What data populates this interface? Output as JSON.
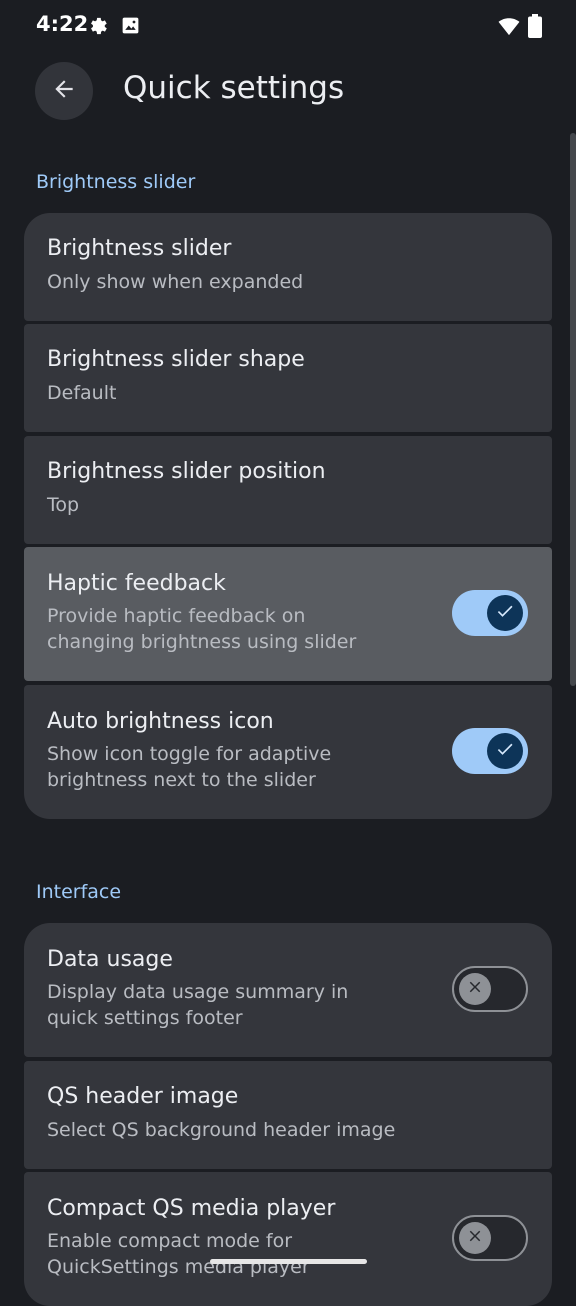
{
  "status_bar": {
    "time": "4:22",
    "icons": [
      "gear-icon",
      "image-icon",
      "wifi-icon",
      "battery-icon"
    ]
  },
  "app_bar": {
    "title": "Quick settings",
    "back_icon": "arrow-left-icon"
  },
  "sections": [
    {
      "header": "Brightness slider",
      "items": [
        {
          "title": "Brightness slider",
          "subtitle": "Only show when expanded",
          "switch": null
        },
        {
          "title": "Brightness slider shape",
          "subtitle": "Default",
          "switch": null
        },
        {
          "title": "Brightness slider position",
          "subtitle": "Top",
          "switch": null
        },
        {
          "title": "Haptic feedback",
          "subtitle_lines": [
            "Provide haptic feedback on",
            "changing brightness using slider"
          ],
          "switch": "on"
        },
        {
          "title": "Auto brightness icon",
          "subtitle_lines": [
            "Show icon toggle for adaptive",
            "brightness next to the slider"
          ],
          "switch": "on"
        }
      ]
    },
    {
      "header": "Interface",
      "items": [
        {
          "title": "Data usage",
          "subtitle_lines": [
            "Display data usage summary in",
            "quick settings footer"
          ],
          "switch": "off"
        },
        {
          "title": "QS header image",
          "subtitle": "Select QS background header image",
          "switch": null
        },
        {
          "title": "Compact QS media player",
          "subtitle_lines": [
            "Enable compact mode for",
            "QuickSettings media player"
          ],
          "switch": "off"
        }
      ]
    }
  ],
  "colors": {
    "background": "#1b1d22",
    "card": "#34363c",
    "card_pressed": "#595c61",
    "accent": "#9fcaf8",
    "switch_thumb_on": "#0d3458"
  }
}
